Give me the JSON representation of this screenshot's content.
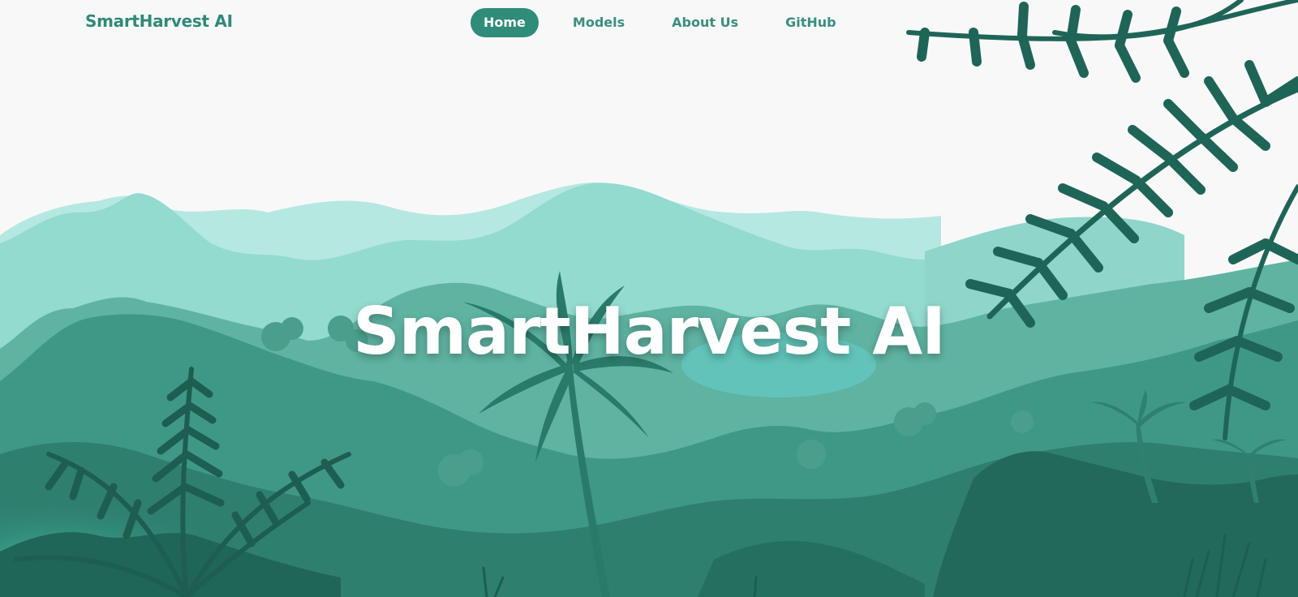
{
  "app": {
    "brand": "SmartHarvest AI"
  },
  "nav": {
    "items": [
      {
        "label": "Home",
        "active": true
      },
      {
        "label": "Models",
        "active": false
      },
      {
        "label": "About Us",
        "active": false
      },
      {
        "label": "GitHub",
        "active": false
      }
    ]
  },
  "hero": {
    "title": "SmartHarvest AI"
  },
  "colors": {
    "accent": "#2f8c79",
    "brand_text": "#2f8a78",
    "sky": "#f8f8f8",
    "far_hills": "#b5e8e0",
    "mid_hills": "#8fd9cd",
    "forest": "#4fa895",
    "dark_foliage": "#1f6657"
  },
  "icons": {
    "scenery": "jungle-landscape-illustration"
  }
}
